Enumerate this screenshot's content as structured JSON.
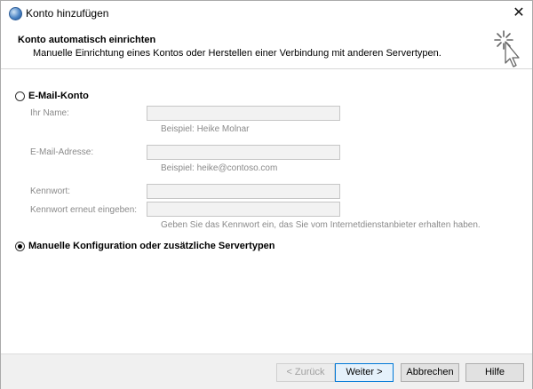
{
  "window": {
    "title": "Konto hinzufügen",
    "close_symbol": "✕"
  },
  "header": {
    "title": "Konto automatisch einrichten",
    "subtitle": "Manuelle Einrichtung eines Kontos oder Herstellen einer Verbindung mit anderen Servertypen."
  },
  "options": {
    "email_account": {
      "label": "E-Mail-Konto",
      "selected": false
    },
    "manual_config": {
      "label": "Manuelle Konfiguration oder zusätzliche Servertypen",
      "selected": true
    }
  },
  "form": {
    "name": {
      "label": "Ihr Name:",
      "value": "",
      "hint": "Beispiel: Heike Molnar"
    },
    "email": {
      "label": "E-Mail-Adresse:",
      "value": "",
      "hint": "Beispiel: heike@contoso.com"
    },
    "password": {
      "label": "Kennwort:",
      "value": ""
    },
    "password_repeat": {
      "label": "Kennwort erneut eingeben:",
      "value": ""
    },
    "password_hint": "Geben Sie das Kennwort ein, das Sie vom Internetdienstanbieter erhalten haben."
  },
  "buttons": {
    "back": "< Zurück",
    "next": "Weiter >",
    "cancel": "Abbrechen",
    "help": "Hilfe"
  },
  "icons": {
    "app": "outlook-globe-icon",
    "wizard": "cursor-sparkle-icon",
    "close": "close-icon"
  }
}
